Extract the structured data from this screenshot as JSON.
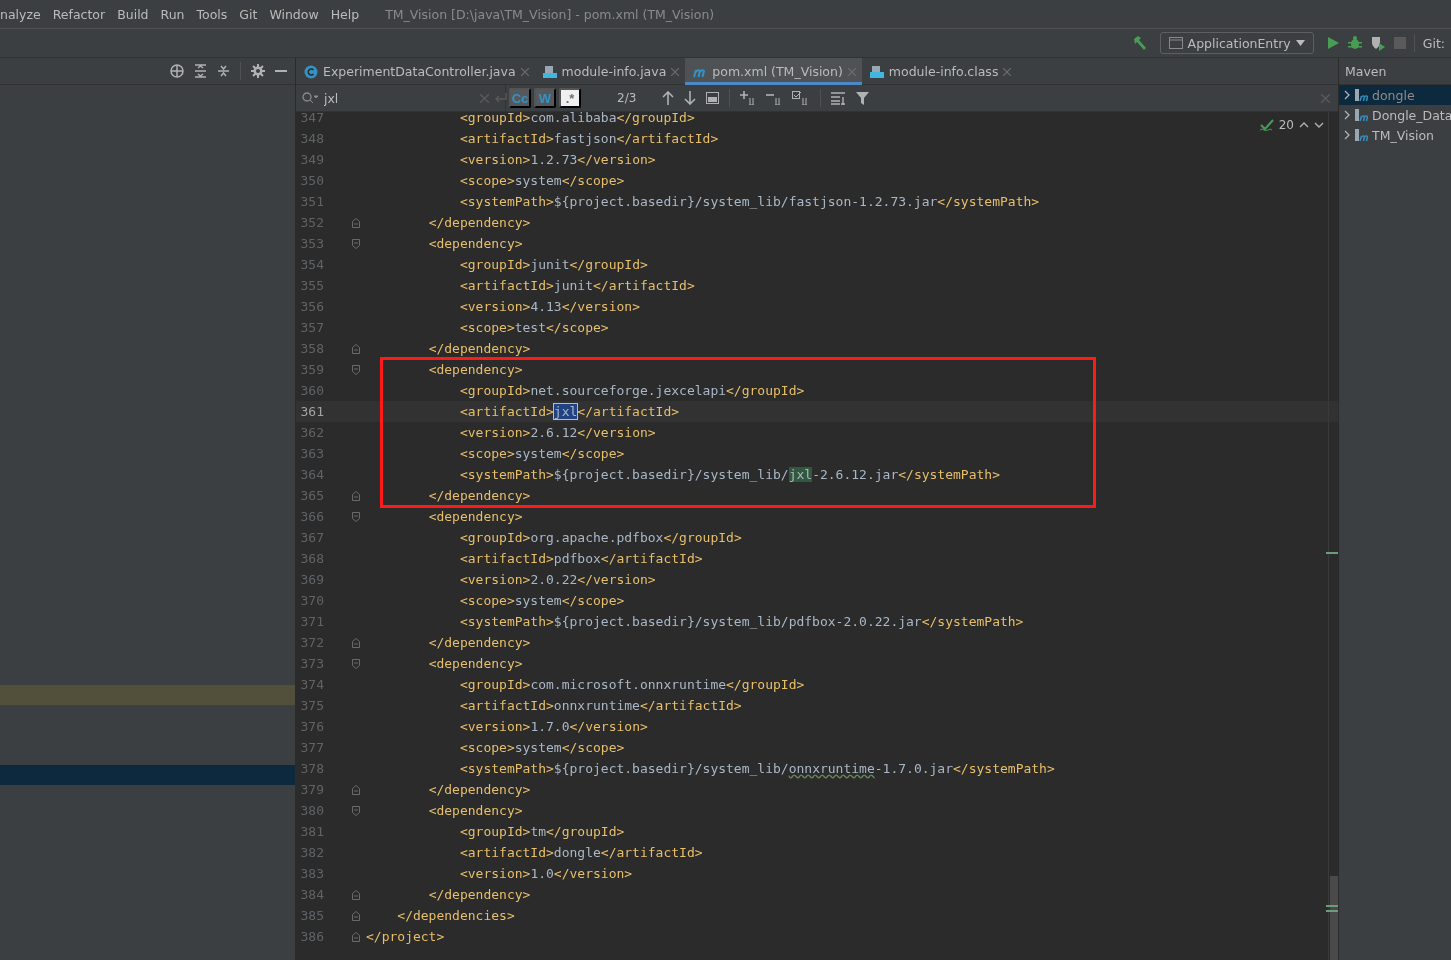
{
  "menu": [
    {
      "label": "nalyze"
    },
    {
      "label": "Refactor"
    },
    {
      "label": "Build"
    },
    {
      "label": "Run"
    },
    {
      "label": "Tools"
    },
    {
      "label": "Git"
    },
    {
      "label": "Window"
    },
    {
      "label": "Help"
    }
  ],
  "window": {
    "title": "TM_Vision [D:\\java\\TM_Vision] - pom.xml (TM_Vision)"
  },
  "toolbar": {
    "run_config": "ApplicationEntry",
    "vcs_label": "Git:"
  },
  "project_tree": {
    "rows": [
      {
        "kind": "match",
        "selected": false
      },
      {
        "kind": "plain",
        "selected": true
      }
    ]
  },
  "tabs": [
    {
      "label": "ExperimentDataController.java",
      "kind": "class",
      "selected": false
    },
    {
      "label": "module-info.java",
      "kind": "java",
      "selected": false
    },
    {
      "label": "pom.xml (TM_Vision)",
      "kind": "maven",
      "selected": true
    },
    {
      "label": "module-info.class",
      "kind": "binary",
      "selected": false
    }
  ],
  "search": {
    "value": "jxl",
    "options": [
      {
        "label": "Cc",
        "on": true
      },
      {
        "label": "W",
        "on": true
      },
      {
        "label": ".*",
        "on": false
      }
    ],
    "count": "2/3"
  },
  "inspection": {
    "count": "20"
  },
  "code": [
    {
      "kind": "line",
      "n": "347",
      "parts": [
        {
          "text": "            <groupId>com.alibaba</groupId>"
        }
      ]
    },
    {
      "kind": "line",
      "n": "348",
      "parts": [
        {
          "text": "            <artifactId>fastjson</artifactId>"
        }
      ]
    },
    {
      "kind": "line",
      "n": "349",
      "parts": [
        {
          "text": "            <version>1.2.73</version>"
        }
      ]
    },
    {
      "kind": "line",
      "n": "350",
      "parts": [
        {
          "text": "            <scope>system</scope>"
        }
      ]
    },
    {
      "kind": "line",
      "n": "351",
      "parts": [
        {
          "text": "            <systemPath>${project.basedir}/system_lib/fastjson-1.2.73.jar</systemPath>"
        }
      ]
    },
    {
      "kind": "line",
      "n": "352",
      "fold_end": true,
      "parts": [
        {
          "text": "        </dependency>"
        }
      ]
    },
    {
      "kind": "line",
      "n": "353",
      "fold_start": true,
      "parts": [
        {
          "text": "        <dependency>"
        }
      ]
    },
    {
      "kind": "line",
      "n": "354",
      "parts": [
        {
          "text": "            <groupId>junit</groupId>"
        }
      ]
    },
    {
      "kind": "line",
      "n": "355",
      "parts": [
        {
          "text": "            <artifactId>junit</artifactId>"
        }
      ]
    },
    {
      "kind": "line",
      "n": "356",
      "parts": [
        {
          "text": "            <version>4.13</version>"
        }
      ]
    },
    {
      "kind": "line",
      "n": "357",
      "parts": [
        {
          "text": "            <scope>test</scope>"
        }
      ]
    },
    {
      "kind": "line",
      "n": "358",
      "fold_end": true,
      "parts": [
        {
          "text": "        </dependency>"
        }
      ]
    },
    {
      "kind": "annotation_box",
      "lines": [
        {
          "kind": "line",
          "n": "359",
          "fold_start": true,
          "parts": [
            {
              "text": "        <dependency>"
            }
          ]
        },
        {
          "kind": "line",
          "n": "360",
          "parts": [
            {
              "text": "            <groupId>net.sourceforge.jexcelapi</groupId>"
            }
          ]
        },
        {
          "kind": "line",
          "n": "361",
          "current": true,
          "parts": [
            {
              "text": "            <artifactId>"
            },
            {
              "text": "jxl",
              "match": true,
              "selected": true
            },
            {
              "text": "</artifactId>"
            }
          ]
        },
        {
          "kind": "line",
          "n": "362",
          "parts": [
            {
              "text": "            <version>2.6.12</version>"
            }
          ]
        },
        {
          "kind": "line",
          "n": "363",
          "parts": [
            {
              "text": "            <scope>system</scope>"
            }
          ]
        },
        {
          "kind": "line",
          "n": "364",
          "parts": [
            {
              "text": "            <systemPath>${project.basedir}/system_lib/"
            },
            {
              "text": "jxl",
              "match": true,
              "selected": false
            },
            {
              "text": "-2.6.12.jar</systemPath>"
            }
          ]
        },
        {
          "kind": "line",
          "n": "365",
          "fold_end": true,
          "parts": [
            {
              "text": "        </dependency>"
            }
          ]
        }
      ]
    },
    {
      "kind": "line",
      "n": "366",
      "fold_start": true,
      "parts": [
        {
          "text": "        <dependency>"
        }
      ]
    },
    {
      "kind": "line",
      "n": "367",
      "parts": [
        {
          "text": "            <groupId>org.apache.pdfbox</groupId>"
        }
      ]
    },
    {
      "kind": "line",
      "n": "368",
      "parts": [
        {
          "text": "            <artifactId>pdfbox</artifactId>"
        }
      ]
    },
    {
      "kind": "line",
      "n": "369",
      "parts": [
        {
          "text": "            <version>2.0.22</version>"
        }
      ]
    },
    {
      "kind": "line",
      "n": "370",
      "parts": [
        {
          "text": "            <scope>system</scope>"
        }
      ]
    },
    {
      "kind": "line",
      "n": "371",
      "parts": [
        {
          "text": "            <systemPath>${project.basedir}/system_lib/pdfbox-2.0.22.jar</systemPath>"
        }
      ]
    },
    {
      "kind": "line",
      "n": "372",
      "fold_end": true,
      "parts": [
        {
          "text": "        </dependency>"
        }
      ]
    },
    {
      "kind": "line",
      "n": "373",
      "fold_start": true,
      "parts": [
        {
          "text": "        <dependency>"
        }
      ]
    },
    {
      "kind": "line",
      "n": "374",
      "parts": [
        {
          "text": "            <groupId>com.microsoft.onnxruntime</groupId>"
        }
      ]
    },
    {
      "kind": "line",
      "n": "375",
      "parts": [
        {
          "text": "            <artifactId>onnxruntime</artifactId>"
        }
      ]
    },
    {
      "kind": "line",
      "n": "376",
      "parts": [
        {
          "text": "            <version>1.7.0</version>"
        }
      ]
    },
    {
      "kind": "line",
      "n": "377",
      "parts": [
        {
          "text": "            <scope>system</scope>"
        }
      ]
    },
    {
      "kind": "line",
      "n": "378",
      "parts": [
        {
          "text": "            <systemPath>${project.basedir}/system_lib/"
        },
        {
          "text": "onnxruntime",
          "typo": true
        },
        {
          "text": "-1.7.0.jar</systemPath>"
        }
      ]
    },
    {
      "kind": "line",
      "n": "379",
      "fold_end": true,
      "parts": [
        {
          "text": "        </dependency>"
        }
      ]
    },
    {
      "kind": "line",
      "n": "380",
      "fold_start": true,
      "parts": [
        {
          "text": "        <dependency>"
        }
      ]
    },
    {
      "kind": "line",
      "n": "381",
      "parts": [
        {
          "text": "            <groupId>tm</groupId>"
        }
      ]
    },
    {
      "kind": "line",
      "n": "382",
      "parts": [
        {
          "text": "            <artifactId>dongle</artifactId>"
        }
      ]
    },
    {
      "kind": "line",
      "n": "383",
      "parts": [
        {
          "text": "            <version>1.0</version>"
        }
      ]
    },
    {
      "kind": "line",
      "n": "384",
      "fold_end": true,
      "parts": [
        {
          "text": "        </dependency>"
        }
      ]
    },
    {
      "kind": "line",
      "n": "385",
      "fold_end": true,
      "parts": [
        {
          "text": "    </dependencies>"
        }
      ]
    },
    {
      "kind": "line",
      "n": "386",
      "fold_end": true,
      "parts": [
        {
          "text": "</project>"
        }
      ]
    }
  ],
  "maven": {
    "title": "Maven",
    "items": [
      {
        "label": "dongle",
        "selected": true,
        "dimmed": true
      },
      {
        "label": "Dongle_Data",
        "selected": false,
        "dimmed": false
      },
      {
        "label": "TM_Vision",
        "selected": false,
        "dimmed": false
      }
    ]
  }
}
